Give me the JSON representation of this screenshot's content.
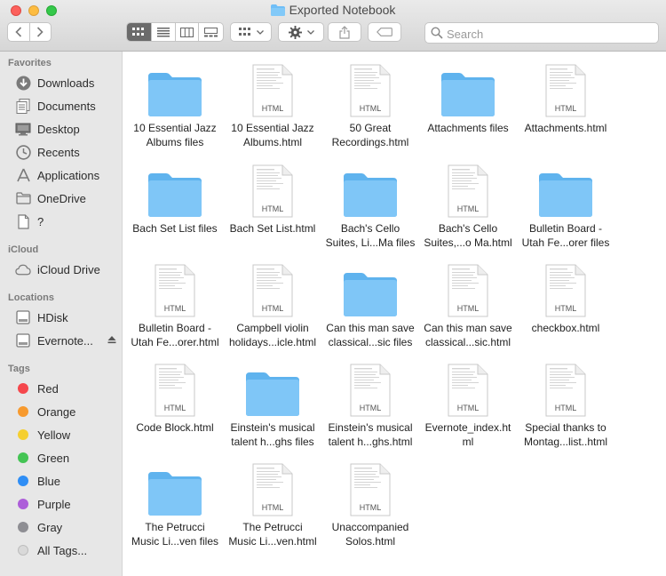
{
  "window": {
    "title": "Exported Notebook",
    "colors": {
      "accent": "#6fbef7",
      "folder": "#76c2f5",
      "selected_segment": "#6b6b6b"
    }
  },
  "toolbar": {
    "back_icon": "chevron-left-icon",
    "forward_icon": "chevron-right-icon",
    "view_modes": [
      "icon-view",
      "list-view",
      "column-view",
      "gallery-view"
    ],
    "active_view": "icon-view",
    "group_icon": "group-by-icon",
    "action_icon": "gear-icon",
    "share_icon": "share-icon",
    "tag_icon": "tag-icon",
    "search_placeholder": "Search"
  },
  "sidebar": {
    "favorites_header": "Favorites",
    "favorites": [
      {
        "label": "Downloads",
        "icon": "download-icon"
      },
      {
        "label": "Documents",
        "icon": "documents-icon"
      },
      {
        "label": "Desktop",
        "icon": "desktop-icon"
      },
      {
        "label": "Recents",
        "icon": "clock-icon"
      },
      {
        "label": "Applications",
        "icon": "applications-icon"
      },
      {
        "label": "OneDrive",
        "icon": "folder-icon"
      },
      {
        "label": "?",
        "icon": "document-icon"
      }
    ],
    "icloud_header": "iCloud",
    "icloud": [
      {
        "label": "iCloud Drive",
        "icon": "cloud-icon"
      }
    ],
    "locations_header": "Locations",
    "locations": [
      {
        "label": "HDisk",
        "icon": "disk-icon"
      },
      {
        "label": "Evernote...",
        "icon": "disk-icon"
      }
    ],
    "tags_header": "Tags",
    "tags": [
      {
        "label": "Red",
        "color": "#f5474c"
      },
      {
        "label": "Orange",
        "color": "#f79a2e"
      },
      {
        "label": "Yellow",
        "color": "#f5cf30"
      },
      {
        "label": "Green",
        "color": "#44c454"
      },
      {
        "label": "Blue",
        "color": "#2f8ef5"
      },
      {
        "label": "Purple",
        "color": "#ad5ed9"
      },
      {
        "label": "Gray",
        "color": "#8e8e93"
      },
      {
        "label": "All Tags...",
        "color": "#d9d9d9"
      }
    ]
  },
  "files": [
    {
      "line1": "10 Essential Jazz",
      "line2": "Albums files",
      "kind": "folder"
    },
    {
      "line1": "10 Essential Jazz",
      "line2": "Albums.html",
      "kind": "html"
    },
    {
      "line1": "50 Great",
      "line2": "Recordings.html",
      "kind": "html"
    },
    {
      "line1": "Attachments files",
      "line2": "",
      "kind": "folder"
    },
    {
      "line1": "Attachments.html",
      "line2": "",
      "kind": "html"
    },
    {
      "line1": "Bach Set List files",
      "line2": "",
      "kind": "folder"
    },
    {
      "line1": "Bach Set List.html",
      "line2": "",
      "kind": "html"
    },
    {
      "line1": "Bach's Cello",
      "line2": "Suites, Li...Ma files",
      "kind": "folder"
    },
    {
      "line1": "Bach's Cello",
      "line2": "Suites,...o Ma.html",
      "kind": "html"
    },
    {
      "line1": "Bulletin Board -",
      "line2": "Utah Fe...orer files",
      "kind": "folder"
    },
    {
      "line1": "Bulletin Board -",
      "line2": "Utah Fe...orer.html",
      "kind": "html"
    },
    {
      "line1": "Campbell violin",
      "line2": "holidays...icle.html",
      "kind": "html"
    },
    {
      "line1": "Can this man save",
      "line2": "classical...sic files",
      "kind": "folder"
    },
    {
      "line1": "Can this man save",
      "line2": "classical...sic.html",
      "kind": "html"
    },
    {
      "line1": "checkbox.html",
      "line2": "",
      "kind": "html"
    },
    {
      "line1": "Code Block.html",
      "line2": "",
      "kind": "html"
    },
    {
      "line1": "Einstein's musical",
      "line2": "talent h...ghs files",
      "kind": "folder"
    },
    {
      "line1": "Einstein's musical",
      "line2": "talent h...ghs.html",
      "kind": "html"
    },
    {
      "line1": "Evernote_index.ht",
      "line2": "ml",
      "kind": "html"
    },
    {
      "line1": "Special thanks to",
      "line2": "Montag...list..html",
      "kind": "html"
    },
    {
      "line1": "The Petrucci",
      "line2": "Music Li...ven files",
      "kind": "folder"
    },
    {
      "line1": "The Petrucci",
      "line2": "Music Li...ven.html",
      "kind": "html"
    },
    {
      "line1": "Unaccompanied",
      "line2": "Solos.html",
      "kind": "html"
    }
  ],
  "html_badge": "HTML"
}
